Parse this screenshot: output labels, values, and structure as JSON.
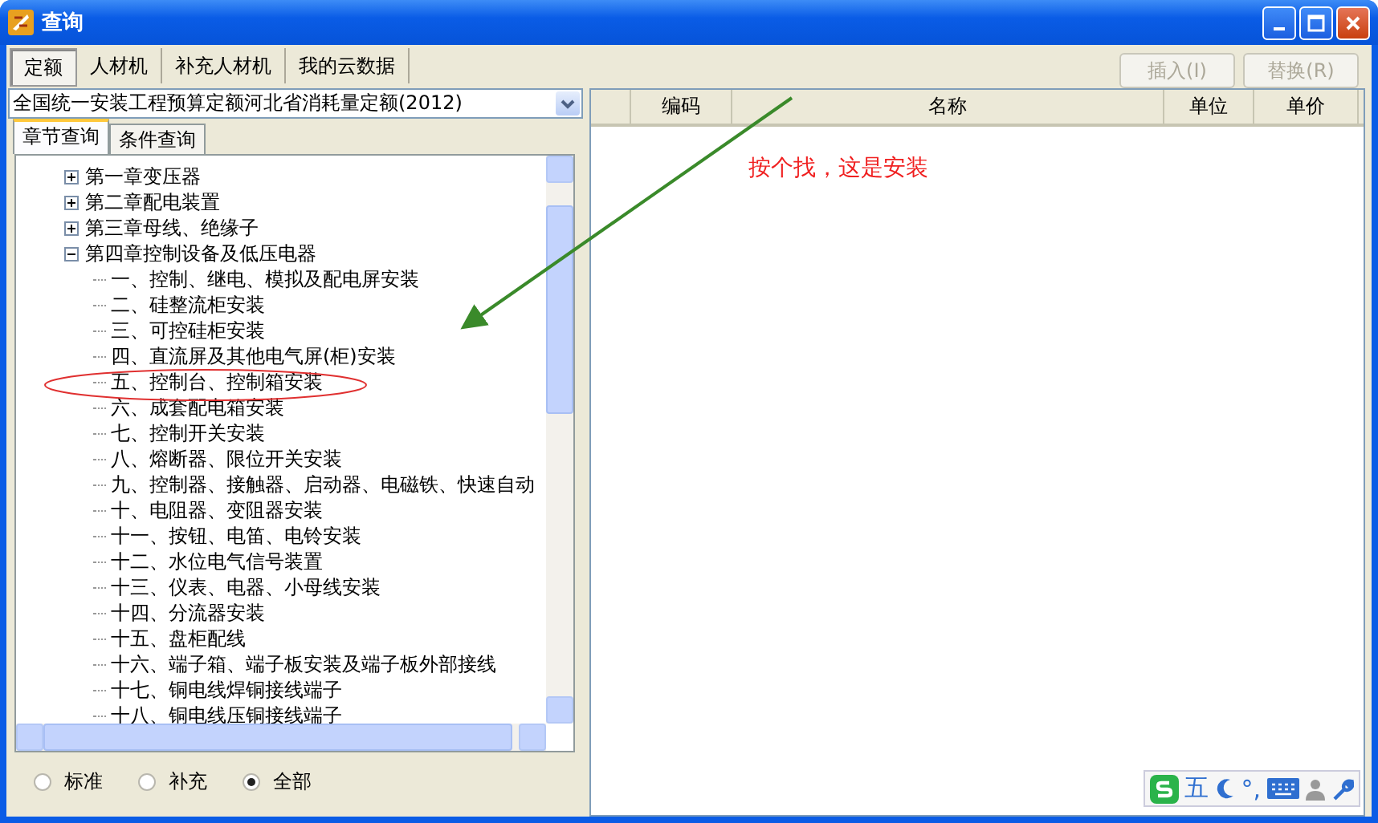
{
  "window": {
    "title": "查询"
  },
  "tabs": [
    {
      "label": "定额",
      "selected": true
    },
    {
      "label": "人材机",
      "selected": false
    },
    {
      "label": "补充人材机",
      "selected": false
    },
    {
      "label": "我的云数据",
      "selected": false
    }
  ],
  "buttons": [
    {
      "label": "插入(I)",
      "disabled": true
    },
    {
      "label": "替换(R)",
      "disabled": true
    }
  ],
  "library_select": {
    "value": "全国统一安装工程预算定额河北省消耗量定额(2012)"
  },
  "subtabs": [
    {
      "label": "章节查询",
      "selected": true
    },
    {
      "label": "条件查询",
      "selected": false
    }
  ],
  "tree": [
    {
      "label": "第一章变压器",
      "expanded": false
    },
    {
      "label": "第二章配电装置",
      "expanded": false
    },
    {
      "label": "第三章母线、绝缘子",
      "expanded": false
    },
    {
      "label": "第四章控制设备及低压电器",
      "expanded": true,
      "children": [
        {
          "label": "一、控制、继电、模拟及配电屏安装"
        },
        {
          "label": "二、硅整流柜安装"
        },
        {
          "label": "三、可控硅柜安装"
        },
        {
          "label": "四、直流屏及其他电气屏(柜)安装"
        },
        {
          "label": "五、控制台、控制箱安装"
        },
        {
          "label": "六、成套配电箱安装"
        },
        {
          "label": "七、控制开关安装"
        },
        {
          "label": "八、熔断器、限位开关安装"
        },
        {
          "label": "九、控制器、接触器、启动器、电磁铁、快速自动"
        },
        {
          "label": "十、电阻器、变阻器安装"
        },
        {
          "label": "十一、按钮、电笛、电铃安装"
        },
        {
          "label": "十二、水位电气信号装置"
        },
        {
          "label": "十三、仪表、电器、小母线安装"
        },
        {
          "label": "十四、分流器安装"
        },
        {
          "label": "十五、盘柜配线"
        },
        {
          "label": "十六、端子箱、端子板安装及端子板外部接线"
        },
        {
          "label": "十七、铜电线焊铜接线端子"
        },
        {
          "label": "十八、铜电线压铜接线端子"
        }
      ]
    }
  ],
  "filters": [
    {
      "label": "标准",
      "selected": false
    },
    {
      "label": "补充",
      "selected": false
    },
    {
      "label": "全部",
      "selected": true
    }
  ],
  "table": {
    "columns": [
      "编码",
      "名称",
      "单位",
      "单价"
    ]
  },
  "annotation": "按个找，这是安装",
  "ime_toolbar": {
    "mode": "五",
    "punctuation": "°,"
  }
}
